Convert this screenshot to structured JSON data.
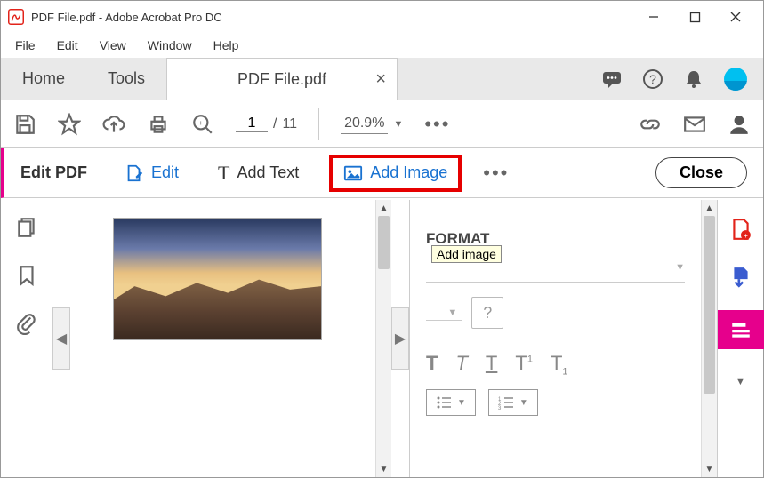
{
  "titlebar": {
    "app_title": "PDF File.pdf - Adobe Acrobat Pro DC"
  },
  "menubar": {
    "items": [
      "File",
      "Edit",
      "View",
      "Window",
      "Help"
    ]
  },
  "tabs": {
    "home": "Home",
    "tools": "Tools",
    "doc": "PDF File.pdf"
  },
  "toolbar": {
    "page_current": "1",
    "page_sep": "/",
    "page_total": "11",
    "zoom": "20.9%"
  },
  "editbar": {
    "title": "Edit PDF",
    "edit": "Edit",
    "addtext": "Add Text",
    "addimage": "Add Image",
    "close": "Close"
  },
  "tooltip": "Add image",
  "format": {
    "heading": "FORMAT"
  }
}
